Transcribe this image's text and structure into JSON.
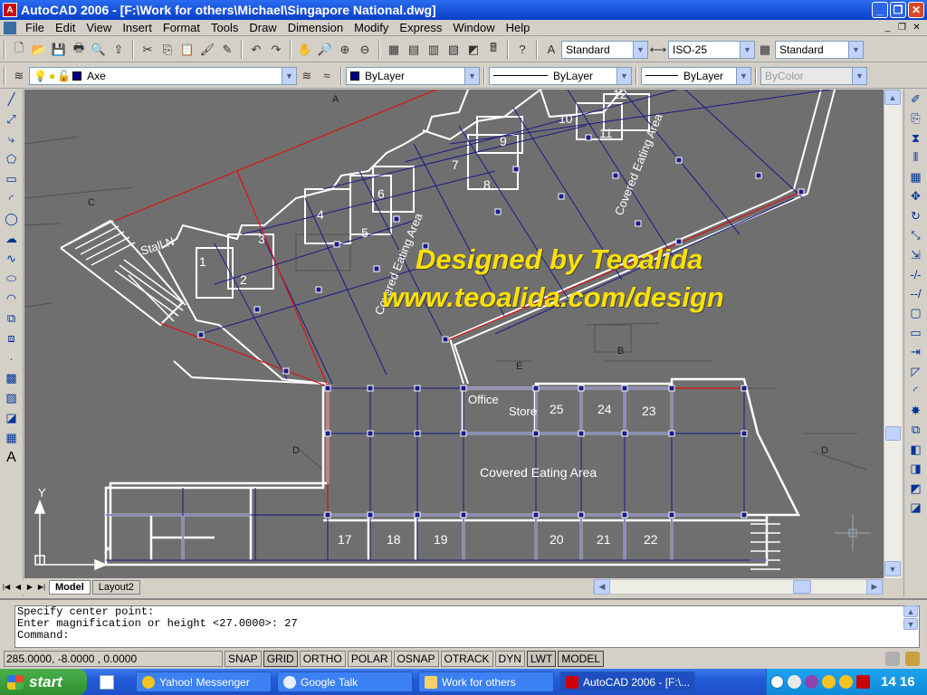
{
  "window": {
    "title": "AutoCAD 2006 - [F:\\Work for others\\Michael\\Singapore National.dwg]",
    "app_icon": "A"
  },
  "menu": [
    "File",
    "Edit",
    "View",
    "Insert",
    "Format",
    "Tools",
    "Draw",
    "Dimension",
    "Modify",
    "Express",
    "Window",
    "Help"
  ],
  "toolbar_styles": {
    "text_style": "Standard",
    "dim_style": "ISO-25",
    "table_style": "Standard"
  },
  "layers": {
    "current_layer": "Axe",
    "color": "ByLayer",
    "linetype": "ByLayer",
    "lineweight": "ByLayer",
    "plot_style": "ByColor"
  },
  "drawing": {
    "watermark_line1": "Designed by Teoalida",
    "watermark_line2": "www.teoalida.com/design",
    "room_labels": {
      "covered_eating_area": "Covered Eating Area",
      "office": "Office",
      "store": "Store",
      "stall": "Stall N",
      "section_a": "A",
      "section_b": "B",
      "section_c": "C",
      "section_d": "D",
      "section_e": "E",
      "axis_y": "Y",
      "axis_x": "X"
    },
    "stall_numbers": [
      "1",
      "2",
      "3",
      "4",
      "5",
      "6",
      "7",
      "8",
      "9",
      "10",
      "11",
      "12",
      "17",
      "18",
      "19",
      "20",
      "21",
      "22",
      "23",
      "24",
      "25"
    ]
  },
  "layout_tabs": [
    "Model",
    "Layout2"
  ],
  "command": {
    "lines": [
      "Specify center point:",
      "Enter magnification or height <27.0000>: 27",
      "Command:"
    ]
  },
  "status": {
    "coordinates": "285.0000, -8.0000 , 0.0000",
    "toggles": [
      {
        "label": "SNAP",
        "on": false
      },
      {
        "label": "GRID",
        "on": true
      },
      {
        "label": "ORTHO",
        "on": false
      },
      {
        "label": "POLAR",
        "on": false
      },
      {
        "label": "OSNAP",
        "on": false
      },
      {
        "label": "OTRACK",
        "on": false
      },
      {
        "label": "DYN",
        "on": false
      },
      {
        "label": "LWT",
        "on": true
      },
      {
        "label": "MODEL",
        "on": true
      }
    ]
  },
  "taskbar": {
    "start": "start",
    "tasks": [
      "Yahoo! Messenger",
      "Google Talk",
      "Work for others",
      "AutoCAD 2006 - [F:\\..."
    ],
    "clock": "14 16"
  },
  "colors": {
    "accent_title": "#0a3fc8",
    "drawing_bg": "#6f6f6f",
    "wall": "#ffffff",
    "grid_axis": "#1a1a8a",
    "red_line": "#dd1111",
    "watermark": "#ffe100"
  }
}
